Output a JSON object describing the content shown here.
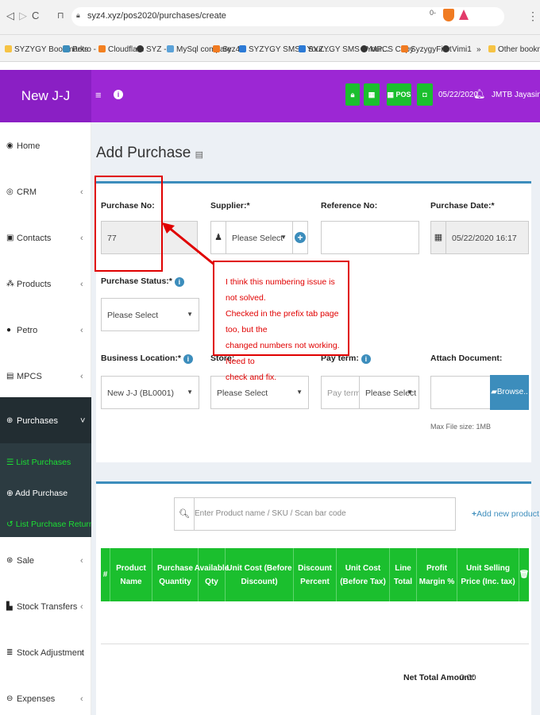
{
  "browser": {
    "url": "syz4.xyz/pos2020/purchases/create",
    "bookmarks": [
      "SYZYGY Bookmarks",
      "Petro - 2",
      "Cloudflare",
      "SYZ - 4",
      "MySql compare",
      "Syz4",
      "SYZYGY SMS - Your...",
      "SYZYGY SMS - Your...",
      "MPCS Copy",
      "SyzygyFirst",
      "Vimi1",
      "»",
      "Other bookmarks"
    ]
  },
  "header": {
    "brand": "New J-J",
    "pos_label": "POS",
    "date": "05/22/2020",
    "user": "JMTB Jayasinghe"
  },
  "sidebar": {
    "items": [
      {
        "label": "Home",
        "icon": "tachometer-icon",
        "chevron": ""
      },
      {
        "label": "CRM",
        "icon": "crm-icon",
        "chevron": "‹"
      },
      {
        "label": "Contacts",
        "icon": "address-book-icon",
        "chevron": "‹"
      },
      {
        "label": "Products",
        "icon": "cubes-icon",
        "chevron": "‹"
      },
      {
        "label": "Petro",
        "icon": "drop-icon",
        "chevron": "‹"
      },
      {
        "label": "MPCS",
        "icon": "list-icon",
        "chevron": "‹"
      },
      {
        "label": "Purchases",
        "icon": "plus-circle-icon",
        "chevron": "˅"
      }
    ],
    "sub_items": [
      "List Purchases",
      "Add Purchase",
      "List Purchase Return"
    ],
    "items_after": [
      {
        "label": "Sale",
        "icon": "arrow-circle-icon",
        "chevron": "‹"
      },
      {
        "label": "Stock Transfers",
        "icon": "truck-icon",
        "chevron": "‹"
      },
      {
        "label": "Stock Adjustment",
        "icon": "database-icon",
        "chevron": "‹"
      },
      {
        "label": "Expenses",
        "icon": "minus-circle-icon",
        "chevron": "‹"
      }
    ]
  },
  "page": {
    "title": "Add Purchase"
  },
  "form": {
    "purchase_no_label": "Purchase No:",
    "purchase_no_value": "77",
    "supplier_label": "Supplier:*",
    "supplier_value": "Please Select",
    "reference_label": "Reference No:",
    "reference_value": "",
    "purchase_date_label": "Purchase Date:*",
    "purchase_date_value": "05/22/2020 16:17",
    "purchase_status_label": "Purchase Status:*",
    "purchase_status_value": "Please Select",
    "business_location_label": "Business Location:*",
    "business_location_value": "New J-J (BL0001)",
    "store_label": "Store:",
    "store_value": "Please Select",
    "pay_term_label": "Pay term:",
    "pay_term_placeholder": "Pay term",
    "pay_term_unit": "Please Select",
    "attach_label": "Attach Document:",
    "browse_label": "Browse..",
    "max_file_size": "Max File size: 1MB"
  },
  "annotation": {
    "lines": [
      "I think this numbering issue is not solved.",
      "Checked in the prefix tab page too, but the",
      "changed numbers not working. Need to",
      "check and fix."
    ]
  },
  "items": {
    "search_placeholder": "Enter Product name / SKU / Scan bar code",
    "add_new_product": "Add new product",
    "columns": [
      "#",
      "Product Name",
      "Purchase Quantity",
      "Available Qty",
      "Unit Cost (Before Discount)",
      "Discount Percent",
      "Unit Cost (Before Tax)",
      "Line Total",
      "Profit Margin %",
      "Unit Selling Price (Inc. tax)"
    ],
    "net_total_label": "Net Total Amount:",
    "net_total_value": "0.00"
  },
  "colors": {
    "header": "#9c27d4",
    "accent": "#1bbf2e",
    "primary": "#3c8dbc",
    "annotation": "#e00000"
  }
}
